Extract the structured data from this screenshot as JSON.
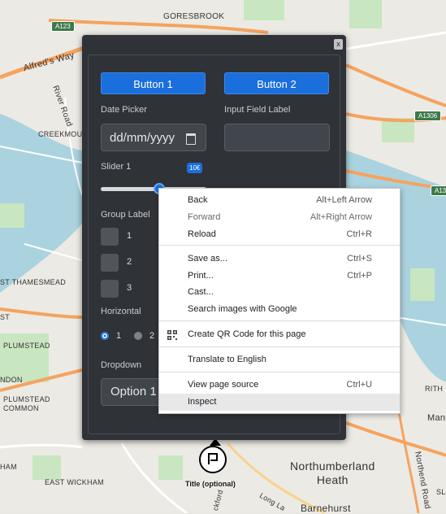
{
  "map": {
    "labels": {
      "goresbrook": "GORESBROOK",
      "alfreds_way": "Alfred's Way",
      "river_road": "River Road",
      "creekmou": "CREEKMOU",
      "thamesmead": "ST THAMESMEAD",
      "st": "ST",
      "plumstead": "PLUMSTEAD",
      "ndon": "NDON",
      "plumstead_common": "PLUMSTEAD\nCOMMON",
      "ham": "HAM",
      "east_wickham": "EAST WICKHAM",
      "northumberland_heath": "Northumberland\nHeath",
      "northend_road": "Northend Road",
      "barnehurst": "Barnehurst",
      "rith": "RITH",
      "manc": "Manc",
      "long_lane": "Long La",
      "sl": "SL",
      "bickford": "ckford"
    },
    "road_badges": {
      "a123": "A123",
      "a1306": "A1306",
      "a13": "A13"
    }
  },
  "panel": {
    "close": "x",
    "button1": "Button 1",
    "button2": "Button 2",
    "date_label": "Date Picker",
    "date_placeholder": "dd/mm/yyyy",
    "input_label": "Input Field Label",
    "slider_label": "Slider 1",
    "slider_value_badge": "10€",
    "slider_fraction": 0.55,
    "group_label": "Group Label",
    "checkboxes": [
      "1",
      "2",
      "3"
    ],
    "horizontal_label": "Horizontal",
    "radios": [
      "1",
      "2"
    ],
    "radio_selected": "1",
    "dropdown_label": "Dropdown",
    "dropdown_value": "Option 1"
  },
  "context_menu": {
    "back": {
      "label": "Back",
      "shortcut": "Alt+Left Arrow"
    },
    "forward": {
      "label": "Forward",
      "shortcut": "Alt+Right Arrow"
    },
    "reload": {
      "label": "Reload",
      "shortcut": "Ctrl+R"
    },
    "save_as": {
      "label": "Save as...",
      "shortcut": "Ctrl+S"
    },
    "print": {
      "label": "Print...",
      "shortcut": "Ctrl+P"
    },
    "cast": {
      "label": "Cast..."
    },
    "search_images": {
      "label": "Search images with Google"
    },
    "qr": {
      "label": "Create QR Code for this page",
      "icon": "qr-code-icon"
    },
    "translate": {
      "label": "Translate to English"
    },
    "view_source": {
      "label": "View page source",
      "shortcut": "Ctrl+U"
    },
    "inspect": {
      "label": "Inspect"
    }
  },
  "marker": {
    "label": "Title (optional)",
    "icon": "flag-icon"
  },
  "colors": {
    "primary": "#1a6fdc",
    "panel_bg": "#2f3237",
    "water": "#aad3df",
    "park": "#c8e6c0",
    "road": "#f5a35f"
  }
}
